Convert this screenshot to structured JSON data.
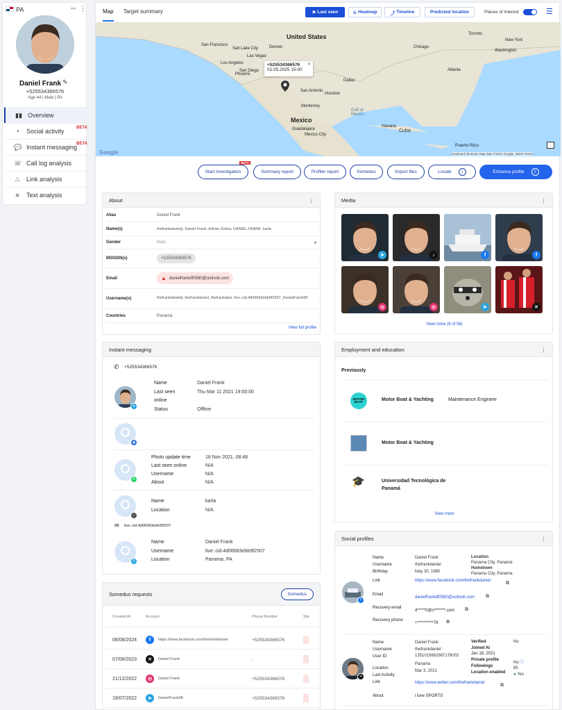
{
  "sidebar": {
    "country_code": "PA",
    "name": "Daniel Frank",
    "phone": "+525534366576",
    "meta": "Age 44 | Male | PA",
    "items": [
      {
        "label": "Overview",
        "icon": "bar-chart-icon",
        "beta": ""
      },
      {
        "label": "Social activity",
        "icon": "rss-icon",
        "beta": "BETA"
      },
      {
        "label": "Instant messaging",
        "icon": "chat-icon",
        "beta": "BETA"
      },
      {
        "label": "Call log analysis",
        "icon": "call-log-icon",
        "beta": ""
      },
      {
        "label": "Link analysis",
        "icon": "link-tree-icon",
        "beta": ""
      },
      {
        "label": "Text analysis",
        "icon": "text-analysis-icon",
        "beta": ""
      }
    ]
  },
  "tabs": [
    "Map",
    "Target summary"
  ],
  "top_buttons": {
    "last_seen": "Last seen",
    "heatmap": "Heatmap",
    "timeline": "Timeline",
    "predicted": "Predicted location",
    "places": "Places of interest"
  },
  "map": {
    "popup_phone": "+525534366576",
    "popup_date": "01.05.2025 15:00",
    "labels": {
      "us": "United States",
      "mexico": "Mexico",
      "cuba": "Cuba",
      "gulf": "Gulf of\nMexico",
      "sf": "San Francisco",
      "la": "Los Angeles",
      "lv": "Las Vegas",
      "sd": "San Diego",
      "chi": "Chicago",
      "ny": "New York",
      "dal": "Dallas",
      "hou": "Houston",
      "sa": "San Antonio",
      "mon": "Monterrey",
      "gua": "Guadalajara",
      "mexcity": "Mexico City",
      "pr": "Puerto Rico",
      "havana": "Havana",
      "denver": "Denver",
      "atlanta": "Atlanta",
      "phoenix": "Phoenix",
      "toronto": "Toronto",
      "dc": "Washington",
      "sl": "Salt Lake City",
      "google": "Google",
      "credits": "Keyboard shortcuts   Map data ©2024 Google, INEGI   Terms"
    }
  },
  "actions": {
    "start": "Start investigation",
    "start_badge": "BETA",
    "summary": "Summary report",
    "profiler": "Profiler report",
    "somedus": "Somedus",
    "import": "Import files",
    "locate": "Locate",
    "locate_count": "1",
    "enhance": "Enhance profile",
    "enhance_count": "3"
  },
  "about": {
    "title": "About",
    "rows": [
      {
        "k": "Alias",
        "v": "Daniel Frank"
      },
      {
        "k": "Name(s)",
        "v": "thefrankdanieljr, Daniel Frank, Adrian Zetina, DANIEL FRANK, karla"
      },
      {
        "k": "Gender",
        "v": "Male"
      },
      {
        "k": "MSISDN(s)",
        "v": "+525534366576"
      },
      {
        "k": "Email",
        "v": "danielfrankdf0580@outlook.com"
      },
      {
        "k": "Username(s)",
        "v": "thefrankdanieljr, thefrankdaniel, thefrankdani, live:.cid.4d06683ebb9f2507, DanielFrank98"
      },
      {
        "k": "Countries",
        "v": "Panama"
      }
    ],
    "footer": "View full profile"
  },
  "media": {
    "title": "Media",
    "footer": "View more (8 of 56)"
  },
  "im": {
    "title": "Instant messaging",
    "phone": "+525534366576",
    "block1": {
      "name_k": "Name",
      "name_v": "Daniel Frank",
      "seen_k": "Last seen",
      "seen_k2": "online",
      "seen_v": "Thu Mar 11 2021 19:00:00",
      "status_k": "Status",
      "status_v": "Offline"
    },
    "block3": {
      "k1": "Photo update time",
      "v1": "18 Nov 2021, 08:48",
      "k2": "Last seen online",
      "v2": "N/A",
      "k3": "Username",
      "v3": "N/A",
      "k4": "About",
      "v4": "N/A"
    },
    "block4": {
      "k1": "Name",
      "v1": "karla",
      "k2": "Location",
      "v2": "N/A"
    },
    "email_line": "live:.cid.4d06683ebb9f2507",
    "block5": {
      "k1": "Name",
      "v1": "Daniel Frank",
      "k2": "Username",
      "v2": "live:.cid.4d06683ebb9f2507",
      "k3": "Location",
      "v3": "Panama, PA"
    }
  },
  "somedus": {
    "title": "Somedus requests",
    "button": "Somedus",
    "headers": [
      "Created At",
      "Account",
      "Phone Number",
      "Sta"
    ],
    "rows": [
      {
        "date": "06/08/2024",
        "account": "https://www.facebook.com/thefrankdaniel",
        "phone": "+525534366576",
        "net": "facebook"
      },
      {
        "date": "07/06/2023",
        "account": "Daniel Frank",
        "phone": "-",
        "net": "x"
      },
      {
        "date": "21/12/2022",
        "account": "Daniel Frank",
        "phone": "+525534366576",
        "net": "instagram"
      },
      {
        "date": "19/07/2022",
        "account": "DanielFrank98",
        "phone": "+525534366576",
        "net": "telegram"
      }
    ]
  },
  "employment": {
    "title": "Employment and education",
    "previously": "Previously",
    "items": [
      {
        "org": "Motor Boat & Yachting",
        "role": "Maintenance Engineer"
      },
      {
        "org": "Motor Boat & Yachting",
        "role": ""
      },
      {
        "org": "Universidad Tecnológica de Panamá",
        "role": ""
      }
    ],
    "footer": "View more"
  },
  "social": {
    "title": "Social profiles",
    "fb": {
      "name_k": "Name",
      "name_v": "Daniel Frank",
      "user_k": "Username",
      "user_v": "thefrankdaniel",
      "bday_k": "Birthday",
      "bday_v": "May 30, 1980",
      "loc_k": "Location",
      "loc_v": "Panama City, Panama",
      "home_k": "Hometown",
      "home_v": "Panama City, Panama",
      "link_k": "Link",
      "link_v": "https://www.facebook.com/thefrankdaniel",
      "email_k": "Email",
      "email_v": "danielfrankdf0580@outlook.com",
      "rec_k": "Recovery email",
      "rec_v": "d*****0@o*******.com",
      "recp_k": "Recovery phone",
      "recp_v": "+**********76"
    },
    "tw": {
      "name_k": "Name",
      "name_v": "Daniel Frank",
      "user_k": "Username",
      "user_v": "thefrankdaniel",
      "uid_k": "User ID",
      "uid_v": "1351015662987178002",
      "loc_k": "Location",
      "loc_v": "Panama",
      "act_k": "Last Activity",
      "act_v": "Mar 3, 2021",
      "link_k": "Link",
      "link_v": "https://www.twitter.com/thefrankdaniel",
      "about_k": "About",
      "about_v": "i love SPORTS",
      "ver_k": "Verified",
      "ver_v": "No",
      "join_k": "Joined At",
      "join_v": "Jan 18, 2021",
      "priv_k": "Private profile",
      "priv_v": "No",
      "fol_k": "Followings",
      "fol_v": "85",
      "locen_k": "Location enabled",
      "locen_v": "Yes"
    }
  }
}
